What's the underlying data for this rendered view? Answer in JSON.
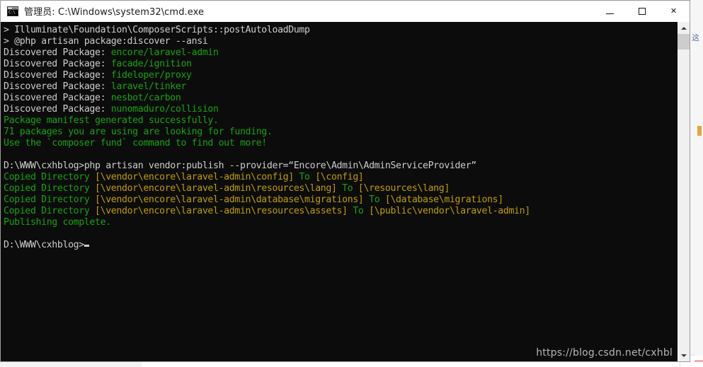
{
  "window": {
    "title": "管理员: C:\\Windows\\system32\\cmd.exe",
    "icon_name": "cmd-exe-icon",
    "icon_text": "C:\\",
    "controls": {
      "minimize_label": "最小化",
      "maximize_label": "最大化",
      "close_glyph": "✕"
    }
  },
  "console": {
    "watermark": "https://blog.csdn.net/cxhbl",
    "cursor": "block",
    "lines": [
      {
        "segments": [
          {
            "text": "> Illuminate\\Foundation\\ComposerScripts::postAutoloadDump",
            "color": "white"
          }
        ]
      },
      {
        "segments": [
          {
            "text": "> @php artisan package:discover --ansi",
            "color": "white"
          }
        ]
      },
      {
        "segments": [
          {
            "text": "Discovered Package: ",
            "color": "white"
          },
          {
            "text": "encore/laravel-admin",
            "color": "green"
          }
        ]
      },
      {
        "segments": [
          {
            "text": "Discovered Package: ",
            "color": "white"
          },
          {
            "text": "facade/ignition",
            "color": "green"
          }
        ]
      },
      {
        "segments": [
          {
            "text": "Discovered Package: ",
            "color": "white"
          },
          {
            "text": "fideloper/proxy",
            "color": "green"
          }
        ]
      },
      {
        "segments": [
          {
            "text": "Discovered Package: ",
            "color": "white"
          },
          {
            "text": "laravel/tinker",
            "color": "green"
          }
        ]
      },
      {
        "segments": [
          {
            "text": "Discovered Package: ",
            "color": "white"
          },
          {
            "text": "nesbot/carbon",
            "color": "green"
          }
        ]
      },
      {
        "segments": [
          {
            "text": "Discovered Package: ",
            "color": "white"
          },
          {
            "text": "nunomaduro/collision",
            "color": "green"
          }
        ]
      },
      {
        "segments": [
          {
            "text": "Package manifest generated successfully.",
            "color": "green"
          }
        ]
      },
      {
        "segments": [
          {
            "text": "71 packages you are using are looking for funding.",
            "color": "green"
          }
        ]
      },
      {
        "segments": [
          {
            "text": "Use the `composer fund` command to find out more!",
            "color": "green"
          }
        ]
      },
      {
        "segments": [
          {
            "text": "",
            "color": "white"
          }
        ]
      },
      {
        "segments": [
          {
            "text": "D:\\WWW\\cxhblog>php artisan vendor:publish --provider=“Encore\\Admin\\AdminServiceProvider”",
            "color": "white"
          }
        ]
      },
      {
        "segments": [
          {
            "text": "Copied Directory ",
            "color": "green"
          },
          {
            "text": "[\\vendor\\encore\\laravel-admin\\config]",
            "color": "yellow"
          },
          {
            "text": " To ",
            "color": "green"
          },
          {
            "text": "[\\config]",
            "color": "yellow"
          }
        ]
      },
      {
        "segments": [
          {
            "text": "Copied Directory ",
            "color": "green"
          },
          {
            "text": "[\\vendor\\encore\\laravel-admin\\resources\\lang]",
            "color": "yellow"
          },
          {
            "text": " To ",
            "color": "green"
          },
          {
            "text": "[\\resources\\lang]",
            "color": "yellow"
          }
        ]
      },
      {
        "segments": [
          {
            "text": "Copied Directory ",
            "color": "green"
          },
          {
            "text": "[\\vendor\\encore\\laravel-admin\\database\\migrations]",
            "color": "yellow"
          },
          {
            "text": " To ",
            "color": "green"
          },
          {
            "text": "[\\database\\migrations]",
            "color": "yellow"
          }
        ]
      },
      {
        "segments": [
          {
            "text": "Copied Directory ",
            "color": "green"
          },
          {
            "text": "[\\vendor\\encore\\laravel-admin\\resources\\assets]",
            "color": "yellow"
          },
          {
            "text": " To ",
            "color": "green"
          },
          {
            "text": "[\\public\\vendor\\laravel-admin]",
            "color": "yellow"
          }
        ]
      },
      {
        "segments": [
          {
            "text": "Publishing complete.",
            "color": "green"
          }
        ]
      },
      {
        "segments": [
          {
            "text": "",
            "color": "white"
          }
        ]
      },
      {
        "segments": [
          {
            "text": "D:\\WWW\\cxhblog>",
            "color": "white"
          },
          {
            "text": "",
            "cursor": true
          }
        ]
      }
    ]
  },
  "scrollbar": {
    "up_arrow": "▲",
    "down_arrow": "▼",
    "thumb_position": "top"
  },
  "desktop": {
    "side_text": "这",
    "colors": {
      "accent_red": "#e53119",
      "accent_orange": "#e8a33d",
      "console_bg": "#0c0c0c",
      "terminal_green": "#16a30f",
      "terminal_yellow": "#c19c00",
      "terminal_white": "#cccccc"
    }
  }
}
